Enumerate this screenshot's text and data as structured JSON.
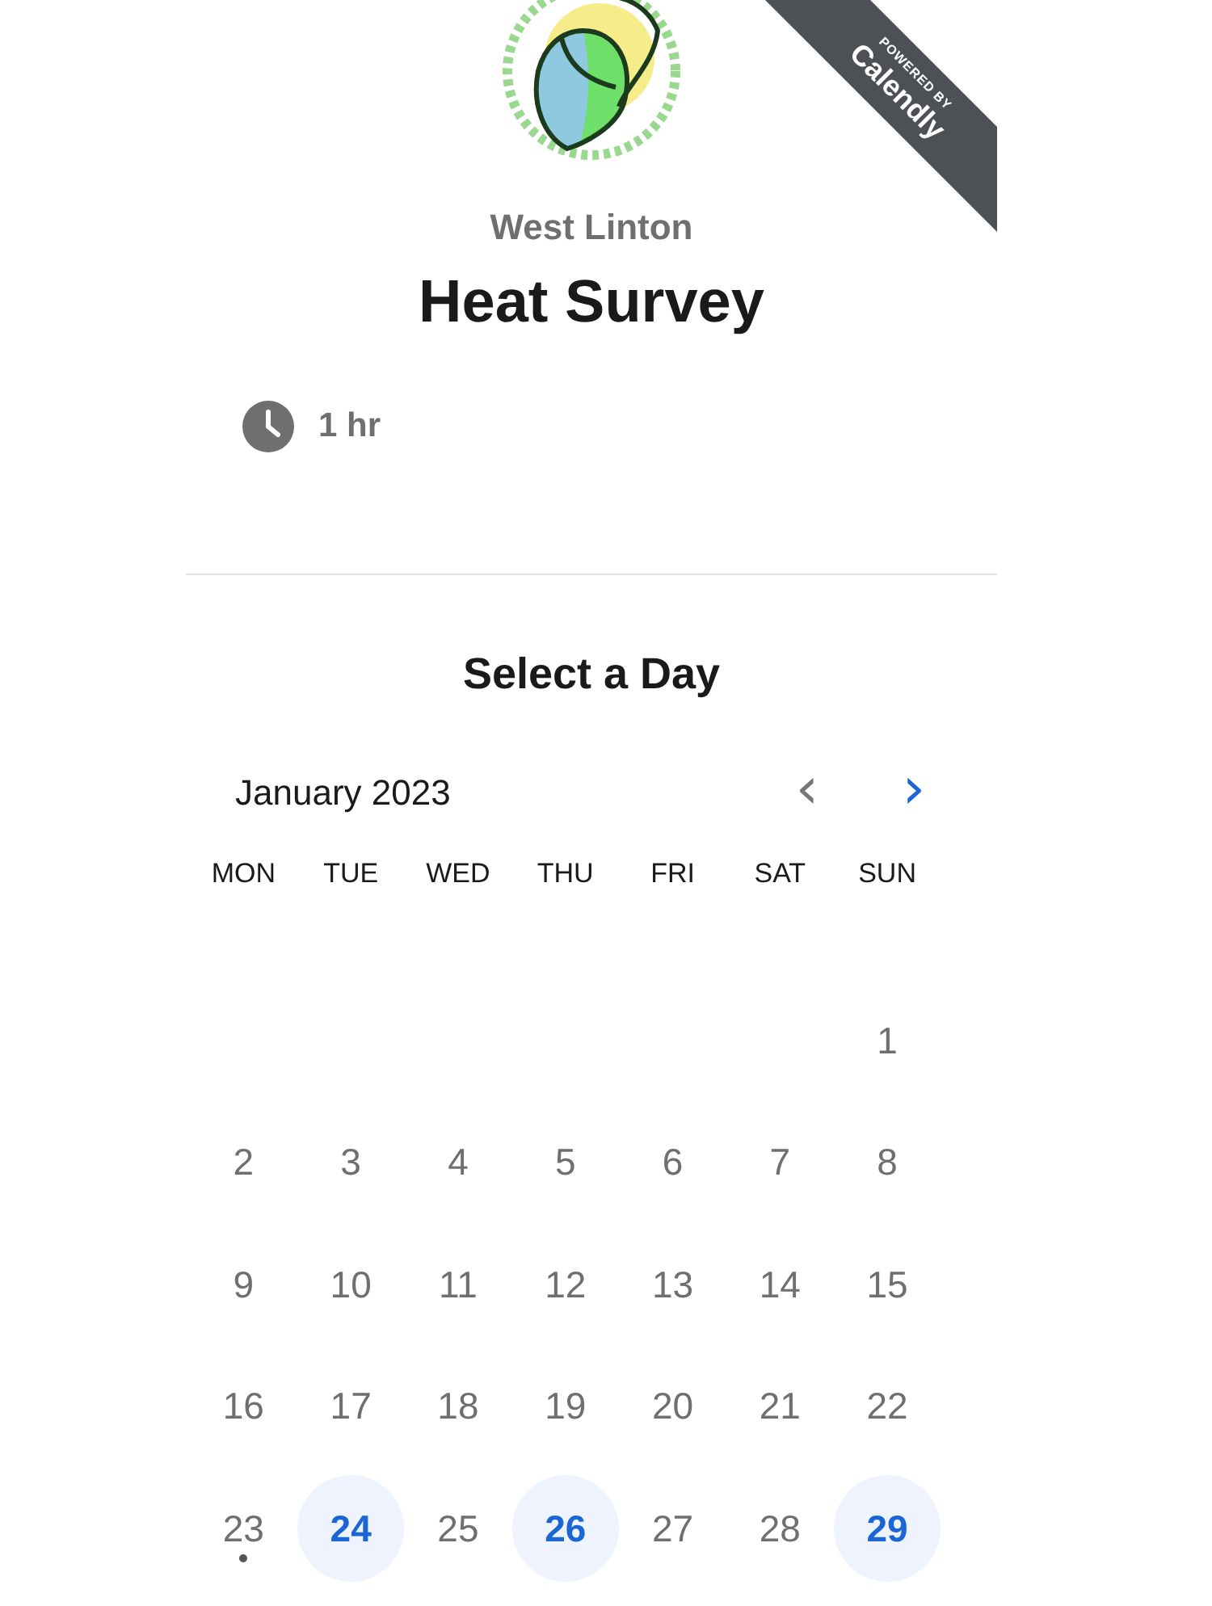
{
  "ribbon": {
    "line_1": "POWERED BY",
    "line_2": "Calendly"
  },
  "organizer": "West Linton",
  "event_title": "Heat Survey",
  "duration": "1 hr",
  "section_title": "Select a Day",
  "calendar": {
    "month": "January 2023",
    "prev": {
      "label": "‹",
      "disabled": true
    },
    "next": {
      "label": "›",
      "disabled": false
    },
    "weekdays": [
      "MON",
      "TUE",
      "WED",
      "THU",
      "FRI",
      "SAT",
      "SUN"
    ],
    "weeks": [
      [
        {
          "day": "1",
          "available": false,
          "today": false
        }
      ],
      [
        {
          "day": "2",
          "available": false,
          "today": false
        },
        {
          "day": "3",
          "available": false,
          "today": false
        },
        {
          "day": "4",
          "available": false,
          "today": false
        },
        {
          "day": "5",
          "available": false,
          "today": false
        },
        {
          "day": "6",
          "available": false,
          "today": false
        },
        {
          "day": "7",
          "available": false,
          "today": false
        },
        {
          "day": "8",
          "available": false,
          "today": false
        }
      ],
      [
        {
          "day": "9",
          "available": false,
          "today": false
        },
        {
          "day": "10",
          "available": false,
          "today": false
        },
        {
          "day": "11",
          "available": false,
          "today": false
        },
        {
          "day": "12",
          "available": false,
          "today": false
        },
        {
          "day": "13",
          "available": false,
          "today": false
        },
        {
          "day": "14",
          "available": false,
          "today": false
        },
        {
          "day": "15",
          "available": false,
          "today": false
        }
      ],
      [
        {
          "day": "16",
          "available": false,
          "today": false
        },
        {
          "day": "17",
          "available": false,
          "today": false
        },
        {
          "day": "18",
          "available": false,
          "today": false
        },
        {
          "day": "19",
          "available": false,
          "today": false
        },
        {
          "day": "20",
          "available": false,
          "today": false
        },
        {
          "day": "21",
          "available": false,
          "today": false
        },
        {
          "day": "22",
          "available": false,
          "today": false
        }
      ],
      [
        {
          "day": "23",
          "available": false,
          "today": true
        },
        {
          "day": "24",
          "available": true,
          "today": false
        },
        {
          "day": "25",
          "available": false,
          "today": false
        },
        {
          "day": "26",
          "available": true,
          "today": false
        },
        {
          "day": "27",
          "available": false,
          "today": false
        },
        {
          "day": "28",
          "available": false,
          "today": false
        },
        {
          "day": "29",
          "available": true,
          "today": false
        }
      ]
    ]
  }
}
